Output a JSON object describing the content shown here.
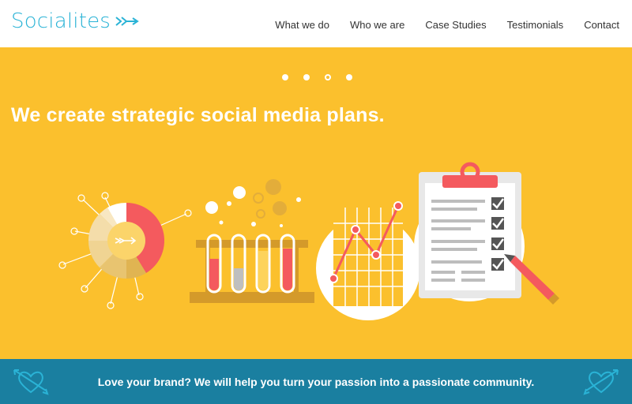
{
  "brand": {
    "name": "Socialites",
    "logo_icon": "arrow-icon",
    "accent_color": "#2ab3d6"
  },
  "nav": {
    "items": [
      "What we do",
      "Who we are",
      "Case Studies",
      "Testimonials",
      "Contact"
    ]
  },
  "hero": {
    "background_color": "#fbc02d",
    "headline": "We create strategic social media plans.",
    "carousel": {
      "slides": 4,
      "active_slide": 3
    },
    "illustrations": [
      "target-wheel-icon",
      "test-tubes-icon",
      "line-chart-icon",
      "clipboard-checklist-icon",
      "pencil-icon"
    ]
  },
  "banner": {
    "background_color": "#1a7fa0",
    "text": "Love your brand? We will help you turn your passion into a passionate community.",
    "icons": [
      "heart-arrow-icon",
      "heart-arrow-icon"
    ]
  }
}
